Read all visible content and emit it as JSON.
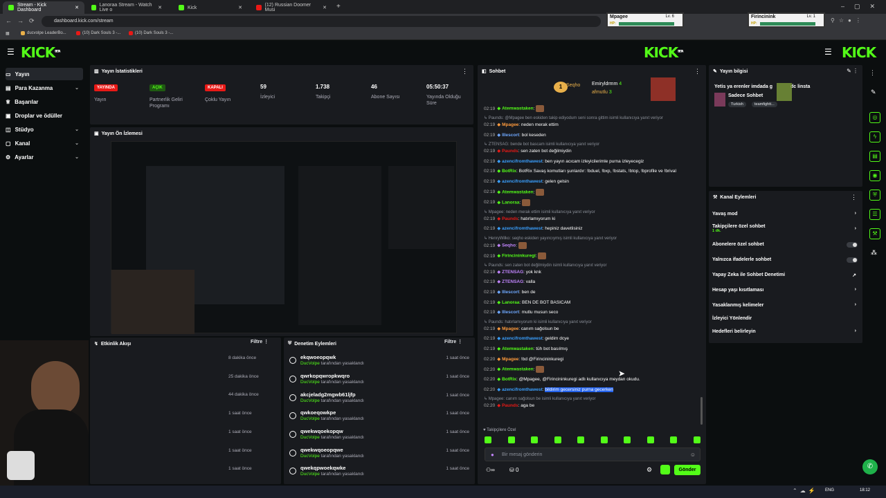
{
  "browser": {
    "tabs": [
      {
        "title": "Stream - Kick Dashboard",
        "active": true
      },
      {
        "title": "Lanoraa Stream - Watch Live o",
        "active": false
      },
      {
        "title": "Kick",
        "active": false
      },
      {
        "title": "(12) Russian Doomer Musi",
        "active": false
      }
    ],
    "url": "dashboard.kick.com/stream",
    "bookmarks": [
      "ducvolpe LeaderBo...",
      "(10) Dark Souls 3 -...",
      "(10) Dark Souls 3 -..."
    ]
  },
  "overlay": {
    "players": [
      {
        "name": "Mpagee",
        "level": "Lv. 6",
        "hp_label": "HP:"
      },
      {
        "name": "Firincinink",
        "level": "Lv. 1",
        "hp_label": "HP:"
      }
    ]
  },
  "header": {
    "logo": "KICK",
    "logo_right": "KICK",
    "beta": "BETA"
  },
  "nav": {
    "items": [
      {
        "label": "Yayın",
        "active": true
      },
      {
        "label": "Para Kazanma",
        "chevron": true
      },
      {
        "label": "Başarılar"
      },
      {
        "label": "Droplar ve ödüller"
      },
      {
        "label": "Stüdyo",
        "chevron": true
      },
      {
        "label": "Kanal",
        "chevron": true
      },
      {
        "label": "Ayarlar",
        "chevron": true
      }
    ]
  },
  "stats": {
    "title": "Yayın İstatistikleri",
    "items": [
      {
        "badge": "YAYINDA",
        "badge_color": "#e91916",
        "label": "Yayın"
      },
      {
        "badge": "AÇIK",
        "badge_color": "#53fc18",
        "label": "Partnerlik Geliri Programı"
      },
      {
        "badge": "KAPALI",
        "badge_color": "#e91916",
        "label": "Çoklu Yayın"
      },
      {
        "value": "59",
        "label": "İzleyici"
      },
      {
        "value": "1.738",
        "label": "Takipçi"
      },
      {
        "value": "46",
        "label": "Abone Sayısı"
      },
      {
        "value": "05:50:37",
        "label": "Yayında Olduğu Süre"
      }
    ]
  },
  "preview": {
    "title": "Yayın Ön İzlemesi"
  },
  "activity": {
    "title": "Etkinlik Akışı",
    "filter": "Filtre",
    "times": [
      "8 dakika önce",
      "25 dakika önce",
      "44 dakika önce",
      "1 saat önce",
      "1 saat önce",
      "1 saat önce",
      "1 saat önce"
    ]
  },
  "moderation": {
    "title": "Denetim Eylemleri",
    "filter": "Filtre",
    "items": [
      {
        "name": "ekqwoeopqwk",
        "by": "DucVolpe",
        "action": "tarafından yasaklandı",
        "time": "1 saat önce"
      },
      {
        "name": "qwrkopqwropkwqro",
        "by": "DucVolpe",
        "action": "tarafından yasaklandı",
        "time": "1 saat önce"
      },
      {
        "name": "akcjeladg2mgwb61ljfp",
        "by": "DucVolpe",
        "action": "tarafından yasaklandı",
        "time": "1 saat önce"
      },
      {
        "name": "qwkoeqowkpe",
        "by": "DucVolpe",
        "action": "tarafından yasaklandı",
        "time": "1 saat önce"
      },
      {
        "name": "qwekwqoekopqw",
        "by": "DucVolpe",
        "action": "tarafından yasaklandı",
        "time": "1 saat önce"
      },
      {
        "name": "qwekwqoeopqwe",
        "by": "DucVolpe",
        "action": "tarafından yasaklandı",
        "time": "1 saat önce"
      },
      {
        "name": "qwekqpwoekqwke",
        "by": "DucVolpe",
        "action": "tarafından yasaklandı",
        "time": "1 saat önce"
      }
    ]
  },
  "chat": {
    "title": "Sohbet",
    "top_users": [
      {
        "name": "Seqho",
        "count": "4"
      },
      {
        "name": "Emiryldrmm",
        "count": "4"
      },
      {
        "name": "afmutlu",
        "count": "3"
      }
    ],
    "lines": [
      {
        "type": "msg",
        "time": "02:19",
        "user": "Atemwastaken",
        "color": "#53fc18",
        "text": ""
      },
      {
        "type": "reply",
        "text": "Paunds: @Mpagee ben eskiden takip ediyodum seni sonra gittim isimli kullanıcıya yanıt veriyor"
      },
      {
        "type": "msg",
        "time": "02:19",
        "user": "Mpagee",
        "color": "#ff9b3d",
        "text": "neden merak ettim"
      },
      {
        "type": "msg",
        "time": "02:19",
        "user": "Illescort",
        "color": "#6fa8ff",
        "text": "bol keseden"
      },
      {
        "type": "reply",
        "text": "ZTENSAG: bende bot bascam isimli kullanıcıya yanıt veriyor"
      },
      {
        "type": "msg",
        "time": "02:19",
        "user": "Paunds",
        "color": "#e91916",
        "text": "sen zaten bot değilmiydin"
      },
      {
        "type": "msg",
        "time": "02:19",
        "user": "azencifromthawest",
        "color": "#3aa0ff",
        "text": "ben yayın acıcam izleyicilerimle purna izleyecegiz"
      },
      {
        "type": "msg",
        "time": "02:19",
        "user": "BotRix",
        "color": "#53fc18",
        "text": "BotRix Savaş komutları şunlardır: !bduel, !bxp, !bstats, !btop, !bprofile ve !brival"
      },
      {
        "type": "msg",
        "time": "02:19",
        "user": "azencifromthawest",
        "color": "#3aa0ff",
        "text": "gelen gelsin"
      },
      {
        "type": "msg",
        "time": "02:19",
        "user": "Atemwastaken",
        "color": "#53fc18",
        "text": ""
      },
      {
        "type": "msg",
        "time": "02:19",
        "user": "Lanoraa",
        "color": "#53fc18",
        "text": ""
      },
      {
        "type": "reply",
        "text": "Mpagee: neden merak ettim isimli kullanıcıya yanıt veriyor"
      },
      {
        "type": "msg",
        "time": "02:19",
        "user": "Paunds",
        "color": "#e91916",
        "text": "hatırlamıyorum ki"
      },
      {
        "type": "msg",
        "time": "02:19",
        "user": "azencifromthawest",
        "color": "#3aa0ff",
        "text": "hepiniz davetlisiniz"
      },
      {
        "type": "reply",
        "text": "HenryWilko: seqho eskiden yayıncıymış isimli kullanıcıya yanıt veriyor"
      },
      {
        "type": "msg",
        "time": "02:19",
        "user": "Seqho",
        "color": "#c084fc",
        "text": ""
      },
      {
        "type": "msg",
        "time": "02:19",
        "user": "Firincininkuregi",
        "color": "#53fc18",
        "text": ""
      },
      {
        "type": "reply",
        "text": "Paunds: sen zaten bot değilmiydin isimli kullanıcıya yanıt veriyor"
      },
      {
        "type": "msg",
        "time": "02:19",
        "user": "ZTENSAG",
        "color": "#c084fc",
        "text": "yok knk"
      },
      {
        "type": "msg",
        "time": "02:19",
        "user": "ZTENSAG",
        "color": "#c084fc",
        "text": "valla"
      },
      {
        "type": "msg",
        "time": "02:19",
        "user": "Illescort",
        "color": "#6fa8ff",
        "text": "ben de"
      },
      {
        "type": "msg",
        "time": "02:19",
        "user": "Lanoraa",
        "color": "#53fc18",
        "text": "BEN DE BOT BASICAM"
      },
      {
        "type": "msg",
        "time": "02:19",
        "user": "Illescort",
        "color": "#6fa8ff",
        "text": "mutlu musun seco"
      },
      {
        "type": "reply",
        "text": "Paunds: hatırlamıyorum ki isimli kullanıcıya yanıt veriyor"
      },
      {
        "type": "msg",
        "time": "02:19",
        "user": "Mpagee",
        "color": "#ff9b3d",
        "text": "canım sağolsun be"
      },
      {
        "type": "msg",
        "time": "02:19",
        "user": "azencifromthawest",
        "color": "#3aa0ff",
        "text": "geldim dcye"
      },
      {
        "type": "msg",
        "time": "02:19",
        "user": "Atemwastaken",
        "color": "#53fc18",
        "text": "tüh bot basılmış"
      },
      {
        "type": "msg",
        "time": "02:20",
        "user": "Mpagee",
        "color": "#ff9b3d",
        "text": "!bd @Firincininkuregi"
      },
      {
        "type": "msg",
        "time": "02:20",
        "user": "Atemwastaken",
        "color": "#53fc18",
        "text": ""
      },
      {
        "type": "msg",
        "time": "02:20",
        "user": "BotRix",
        "color": "#53fc18",
        "text": "@Mpagee, @Firincininkuregi adlı kullanıcıya meydan okudu."
      },
      {
        "type": "msg",
        "time": "02:20",
        "user": "azencifromthawest",
        "color": "#3aa0ff",
        "text": "bildirim gecersiniz purna gecerken",
        "highlight": true
      },
      {
        "type": "reply",
        "text": "Mpagee: canım sağolsun be isimli kullanıcıya yanıt veriyor"
      },
      {
        "type": "msg",
        "time": "02:20",
        "user": "Paunds",
        "color": "#e91916",
        "text": "aga be"
      }
    ],
    "followers_only": "Takipçilere Özel",
    "placeholder": "Bir mesaj gönderin",
    "send": "Gönder",
    "points": "0"
  },
  "stream_info": {
    "title": "Yayın bilgisi",
    "stream_title": "Yetis ya erenler imdada g",
    "title_suffix": "dc linsta",
    "category": "Sadece Sohbet",
    "tags": [
      "Turkish",
      "teamfightt..."
    ]
  },
  "channel_actions": {
    "title": "Kanal Eylemleri",
    "items": [
      {
        "label": "Yavaş mod",
        "control": "chevron"
      },
      {
        "label": "Takipçilere özel sohbet",
        "sub": "1 dk.",
        "control": "chevron"
      },
      {
        "label": "Abonelere özel sohbet",
        "control": "toggle"
      },
      {
        "label": "Yalnızca ifadelerle sohbet",
        "control": "toggle"
      },
      {
        "label": "Yapay Zeka ile Sohbet Denetimi",
        "control": "external"
      },
      {
        "label": "Hesap yaşı kısıtlaması",
        "control": "chevron"
      },
      {
        "label": "Yasaklanmış kelimeler",
        "control": "chevron"
      },
      {
        "label": "İzleyici Yönlendir",
        "control": "none"
      },
      {
        "label": "Hedefleri belirleyin",
        "control": "chevron"
      }
    ]
  },
  "taskbar": {
    "lang": "ENG",
    "clock": "18:12"
  }
}
